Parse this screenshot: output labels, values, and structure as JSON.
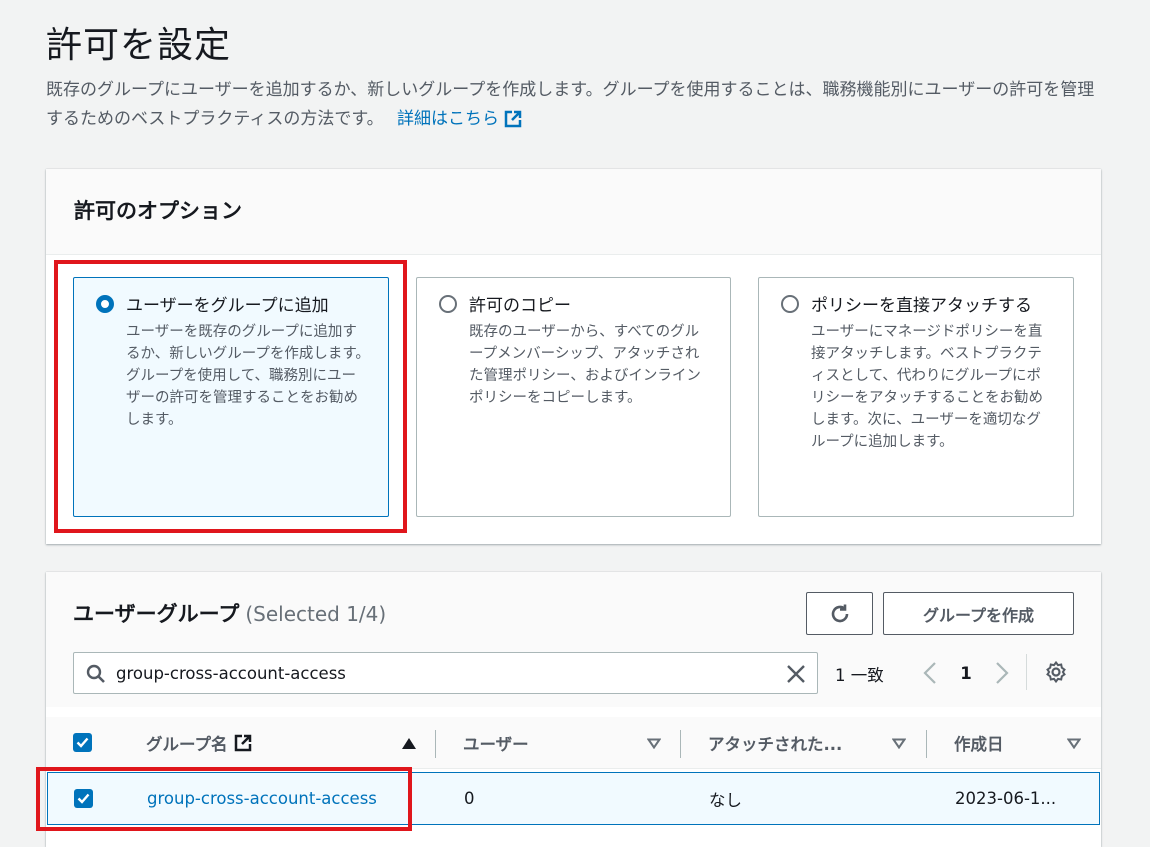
{
  "page": {
    "title": "許可を設定",
    "description": "既存のグループにユーザーを追加するか、新しいグループを作成します。グループを使用することは、職務機能別にユーザーの許可を管理するためのベストプラクティスの方法です。",
    "learn_more": "詳細はこちら"
  },
  "options": {
    "title": "許可のオプション",
    "tiles": [
      {
        "label": "ユーザーをグループに追加",
        "desc": "ユーザーを既存のグループに追加するか、新しいグループを作成します。グループを使用して、職務別にユーザーの許可を管理することをお勧めします。",
        "selected": true
      },
      {
        "label": "許可のコピー",
        "desc": "既存のユーザーから、すべてのグループメンバーシップ、アタッチされた管理ポリシー、およびインラインポリシーをコピーします。",
        "selected": false
      },
      {
        "label": "ポリシーを直接アタッチする",
        "desc": "ユーザーにマネージドポリシーを直接アタッチします。ベストプラクティスとして、代わりにグループにポリシーをアタッチすることをお勧めします。次に、ユーザーを適切なグループに追加します。",
        "selected": false
      }
    ]
  },
  "groups": {
    "title": "ユーザーグループ",
    "count": "(Selected 1/4)",
    "create_button": "グループを作成",
    "search_value": "group-cross-account-access",
    "match_count": "1 一致",
    "current_page": "1",
    "columns": {
      "name": "グループ名",
      "users": "ユーザー",
      "attached": "アタッチされた...",
      "created": "作成日"
    },
    "rows": [
      {
        "name": "group-cross-account-access",
        "users": "0",
        "attached": "なし",
        "created": "2023-06-1..."
      }
    ]
  },
  "colors": {
    "accent": "#0073bb",
    "highlight": "#e0161c",
    "background": "#f2f3f3"
  }
}
